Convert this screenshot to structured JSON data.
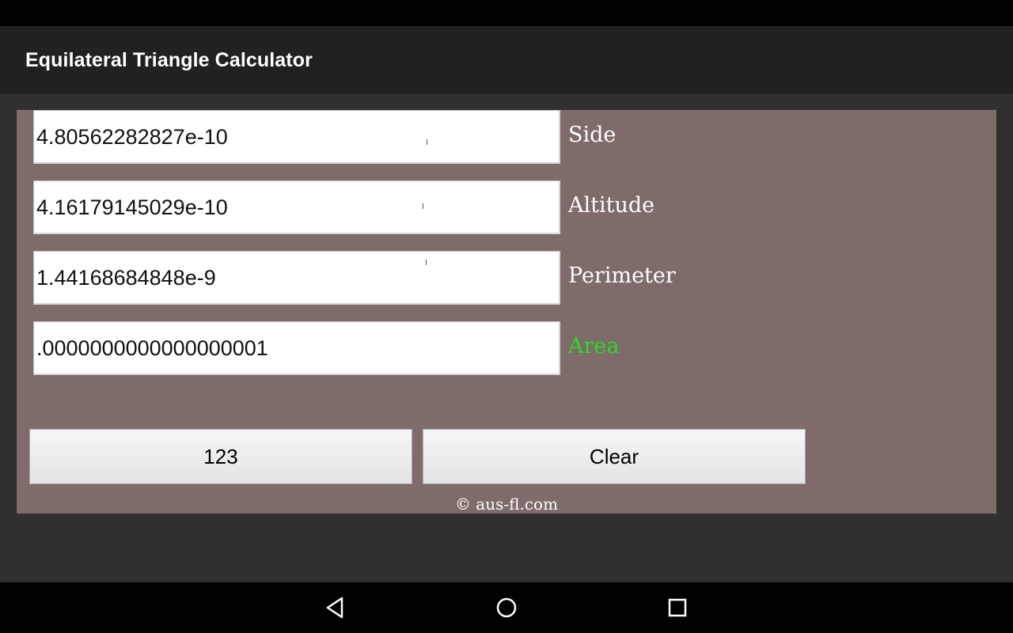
{
  "app": {
    "title": "Equilateral Triangle Calculator"
  },
  "fields": [
    {
      "value": "4.80562282827e-10",
      "label": "Side",
      "active": false
    },
    {
      "value": "4.16179145029e-10",
      "label": "Altitude",
      "active": false
    },
    {
      "value": "1.44168684848e-9",
      "label": "Perimeter",
      "active": false
    },
    {
      "value": ".0000000000000000001",
      "label": "Area",
      "active": true
    }
  ],
  "buttons": {
    "keypad_label": "123",
    "clear_label": "Clear"
  },
  "footer": {
    "copyright": "© aus-fl.com"
  },
  "colors": {
    "panel_bg": "#806b6b",
    "active_label": "#22e022",
    "app_bar": "#212121"
  },
  "nav": {
    "icons": [
      "back-icon",
      "home-icon",
      "recents-icon"
    ]
  }
}
